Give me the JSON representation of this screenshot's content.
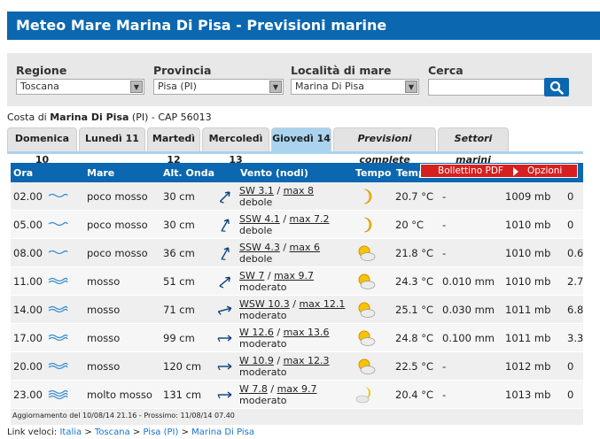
{
  "header": {
    "title": "Meteo Mare Marina Di Pisa - Previsioni marine"
  },
  "search": {
    "regione_label": "Regione",
    "regione_value": "Toscana",
    "provincia_label": "Provincia",
    "provincia_value": "Pisa (PI)",
    "localita_label": "Località di mare",
    "localita_value": "Marina Di Pisa",
    "cerca_label": "Cerca",
    "cerca_value": ""
  },
  "coast": {
    "prefix": "Costa di",
    "name": "Marina Di Pisa",
    "suffix": "(PI) - CAP 56013"
  },
  "tabs": [
    {
      "label": "Domenica 10"
    },
    {
      "label": "Lunedì 11"
    },
    {
      "label": "Martedì 12"
    },
    {
      "label": "Mercoledì 13"
    },
    {
      "label": "Giovedì 14"
    },
    {
      "label": "Previsioni complete"
    },
    {
      "label": "Settori marini"
    }
  ],
  "table": {
    "headers": [
      "Ora",
      "Mare",
      "Alt. Onda",
      "Vento (nodi)",
      "Tempo",
      "Temp"
    ],
    "rows": [
      {
        "ora": "02.00",
        "mare": "poco mosso",
        "onda": "30 cm",
        "vento_dir": "SW 3.1",
        "vento_max": "max 8",
        "vento_desc": "debole",
        "temp": "20.7 °C",
        "pioggia": "-",
        "press": "1009 mb",
        "extra": "0",
        "icon": "moon-icon",
        "sea": "calm"
      },
      {
        "ora": "05.00",
        "mare": "poco mosso",
        "onda": "30 cm",
        "vento_dir": "SSW 4.1",
        "vento_max": "max 7.2",
        "vento_desc": "debole",
        "temp": "20 °C",
        "pioggia": "-",
        "press": "1010 mb",
        "extra": "0",
        "icon": "moon-icon",
        "sea": "calm"
      },
      {
        "ora": "08.00",
        "mare": "poco mosso",
        "onda": "36 cm",
        "vento_dir": "SSW 4.3",
        "vento_max": "max 6",
        "vento_desc": "debole",
        "temp": "21.8 °C",
        "pioggia": "-",
        "press": "1010 mb",
        "extra": "0.6",
        "icon": "sun-cloud-icon",
        "sea": "calm"
      },
      {
        "ora": "11.00",
        "mare": "mosso",
        "onda": "51 cm",
        "vento_dir": "SW 7",
        "vento_max": "max 9.7",
        "vento_desc": "moderato",
        "temp": "24.3 °C",
        "pioggia": "0.010 mm",
        "press": "1010 mb",
        "extra": "2.7",
        "icon": "sun-cloud-icon",
        "sea": "rough"
      },
      {
        "ora": "14.00",
        "mare": "mosso",
        "onda": "71 cm",
        "vento_dir": "WSW 10.3",
        "vento_max": "max 12.1",
        "vento_desc": "moderato",
        "temp": "25.1 °C",
        "pioggia": "0.030 mm",
        "press": "1011 mb",
        "extra": "6.8",
        "icon": "sun-cloud-icon",
        "sea": "rough"
      },
      {
        "ora": "17.00",
        "mare": "mosso",
        "onda": "99 cm",
        "vento_dir": "W 12.6",
        "vento_max": "max 13.6",
        "vento_desc": "moderato",
        "temp": "24.8 °C",
        "pioggia": "0.100 mm",
        "press": "1011 mb",
        "extra": "3.3",
        "icon": "sun-cloud-icon",
        "sea": "rough"
      },
      {
        "ora": "20.00",
        "mare": "mosso",
        "onda": "120 cm",
        "vento_dir": "W 10.9",
        "vento_max": "max 12.3",
        "vento_desc": "moderato",
        "temp": "22.5 °C",
        "pioggia": "-",
        "press": "1012 mb",
        "extra": "0",
        "icon": "sun-cloud-icon",
        "sea": "rough"
      },
      {
        "ora": "23.00",
        "mare": "molto mosso",
        "onda": "131 cm",
        "vento_dir": "W 7.8",
        "vento_max": "max 9.7",
        "vento_desc": "moderato",
        "temp": "20.4 °C",
        "pioggia": "-",
        "press": "1013 mb",
        "extra": "0",
        "icon": "moon-cloud-icon",
        "sea": "very-rough"
      }
    ],
    "footer": "Aggiornamento del 10/08/14 21.16 - Prossimo: 11/08/14 07.40"
  },
  "dropbar": {
    "pdf_label": "Bollettino PDF",
    "options_label": "Opzioni"
  },
  "links": {
    "label": "Link veloci:",
    "items": [
      {
        "label": "Italia"
      },
      {
        "label": "Toscana"
      },
      {
        "label": "Pisa (PI)"
      },
      {
        "label": "Marina Di Pisa"
      }
    ]
  },
  "colors": {
    "brand": "#0a67b0",
    "tab_active": "#a9d3ef",
    "accent_red": "#d6201f",
    "link": "#1a73c9"
  }
}
